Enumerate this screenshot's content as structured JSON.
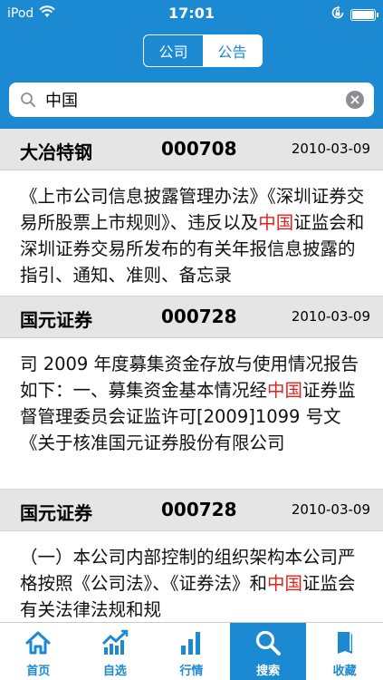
{
  "status_bar": {
    "carrier": "iPod",
    "time": "17:01"
  },
  "nav": {
    "segments": [
      {
        "label": "公司",
        "active": false
      },
      {
        "label": "公告",
        "active": true
      }
    ]
  },
  "search": {
    "value": "中国",
    "placeholder": ""
  },
  "results": [
    {
      "name": "大冶特钢",
      "code": "000708",
      "date": "2010-03-09",
      "body_before": "《上市公司信息披露管理办法》《深圳证券交易所股票上市规则》、违反以及",
      "highlight": "中国",
      "body_after": "证监会和深圳证券交易所发布的有关年报信息披露的指引、通知、准则、备忘录"
    },
    {
      "name": "国元证券",
      "code": "000728",
      "date": "2010-03-09",
      "body_before": "司 2009 年度募集资金存放与使用情况报告如下：一、募集资金基本情况经",
      "highlight": "中国",
      "body_after": "证券监督管理委员会证监许可[2009]1099 号文《关于核准国元证券股份有限公司"
    },
    {
      "name": "国元证券",
      "code": "000728",
      "date": "2010-03-09",
      "body_before": "（一）本公司内部控制的组织架构本公司严格按照《公司法》、《证券法》和",
      "highlight": "中国",
      "body_after": "证监会有关法律法规和规"
    }
  ],
  "tab_bar": {
    "tabs": [
      {
        "label": "首页",
        "icon": "home-icon",
        "active": false
      },
      {
        "label": "自选",
        "icon": "trend-chart-icon",
        "active": false
      },
      {
        "label": "行情",
        "icon": "bar-chart-icon",
        "active": false
      },
      {
        "label": "搜索",
        "icon": "search-icon",
        "active": true
      },
      {
        "label": "收藏",
        "icon": "bookmark-icon",
        "active": false
      }
    ]
  },
  "colors": {
    "brand": "#1b8ad3",
    "highlight": "#e0211c",
    "header_bg": "#e5e5e5"
  }
}
